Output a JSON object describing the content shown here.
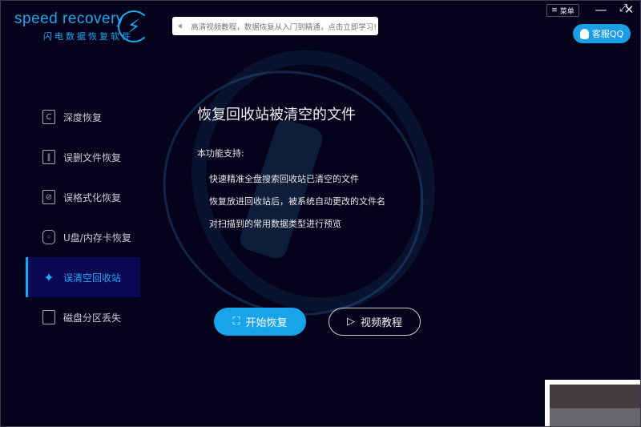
{
  "brand": {
    "name": "speed recovery",
    "subtitle": "闪电数据恢复软件"
  },
  "notice": {
    "text": "高清视频教程，数据恢复从入门到精通，点击立即学习!"
  },
  "window": {
    "menu_label": "菜单",
    "minimize": "—",
    "maximize": "⤢",
    "close": "✕"
  },
  "support": {
    "label": "客服QQ"
  },
  "sidebar": {
    "items": [
      {
        "label": "深度恢复",
        "icon": "C"
      },
      {
        "label": "误删文件恢复",
        "icon": "‖"
      },
      {
        "label": "误格式化恢复",
        "icon": "⊘"
      },
      {
        "label": "U盘/内存卡恢复",
        "icon": "◦"
      },
      {
        "label": "误清空回收站",
        "icon": "✦"
      },
      {
        "label": "磁盘分区丢失",
        "icon": ""
      }
    ]
  },
  "main": {
    "title": "恢复回收站被清空的文件",
    "subtitle": "本功能支持:",
    "features": [
      "快速精准全盘搜索回收站已清空的文件",
      "恢复放进回收站后，被系统自动更改的文件名",
      "对扫描到的常用数据类型进行预览"
    ],
    "start_button": "开始恢复",
    "video_button": "视频教程"
  },
  "colors": {
    "accent": "#19a3e8",
    "background": "#05031c"
  }
}
